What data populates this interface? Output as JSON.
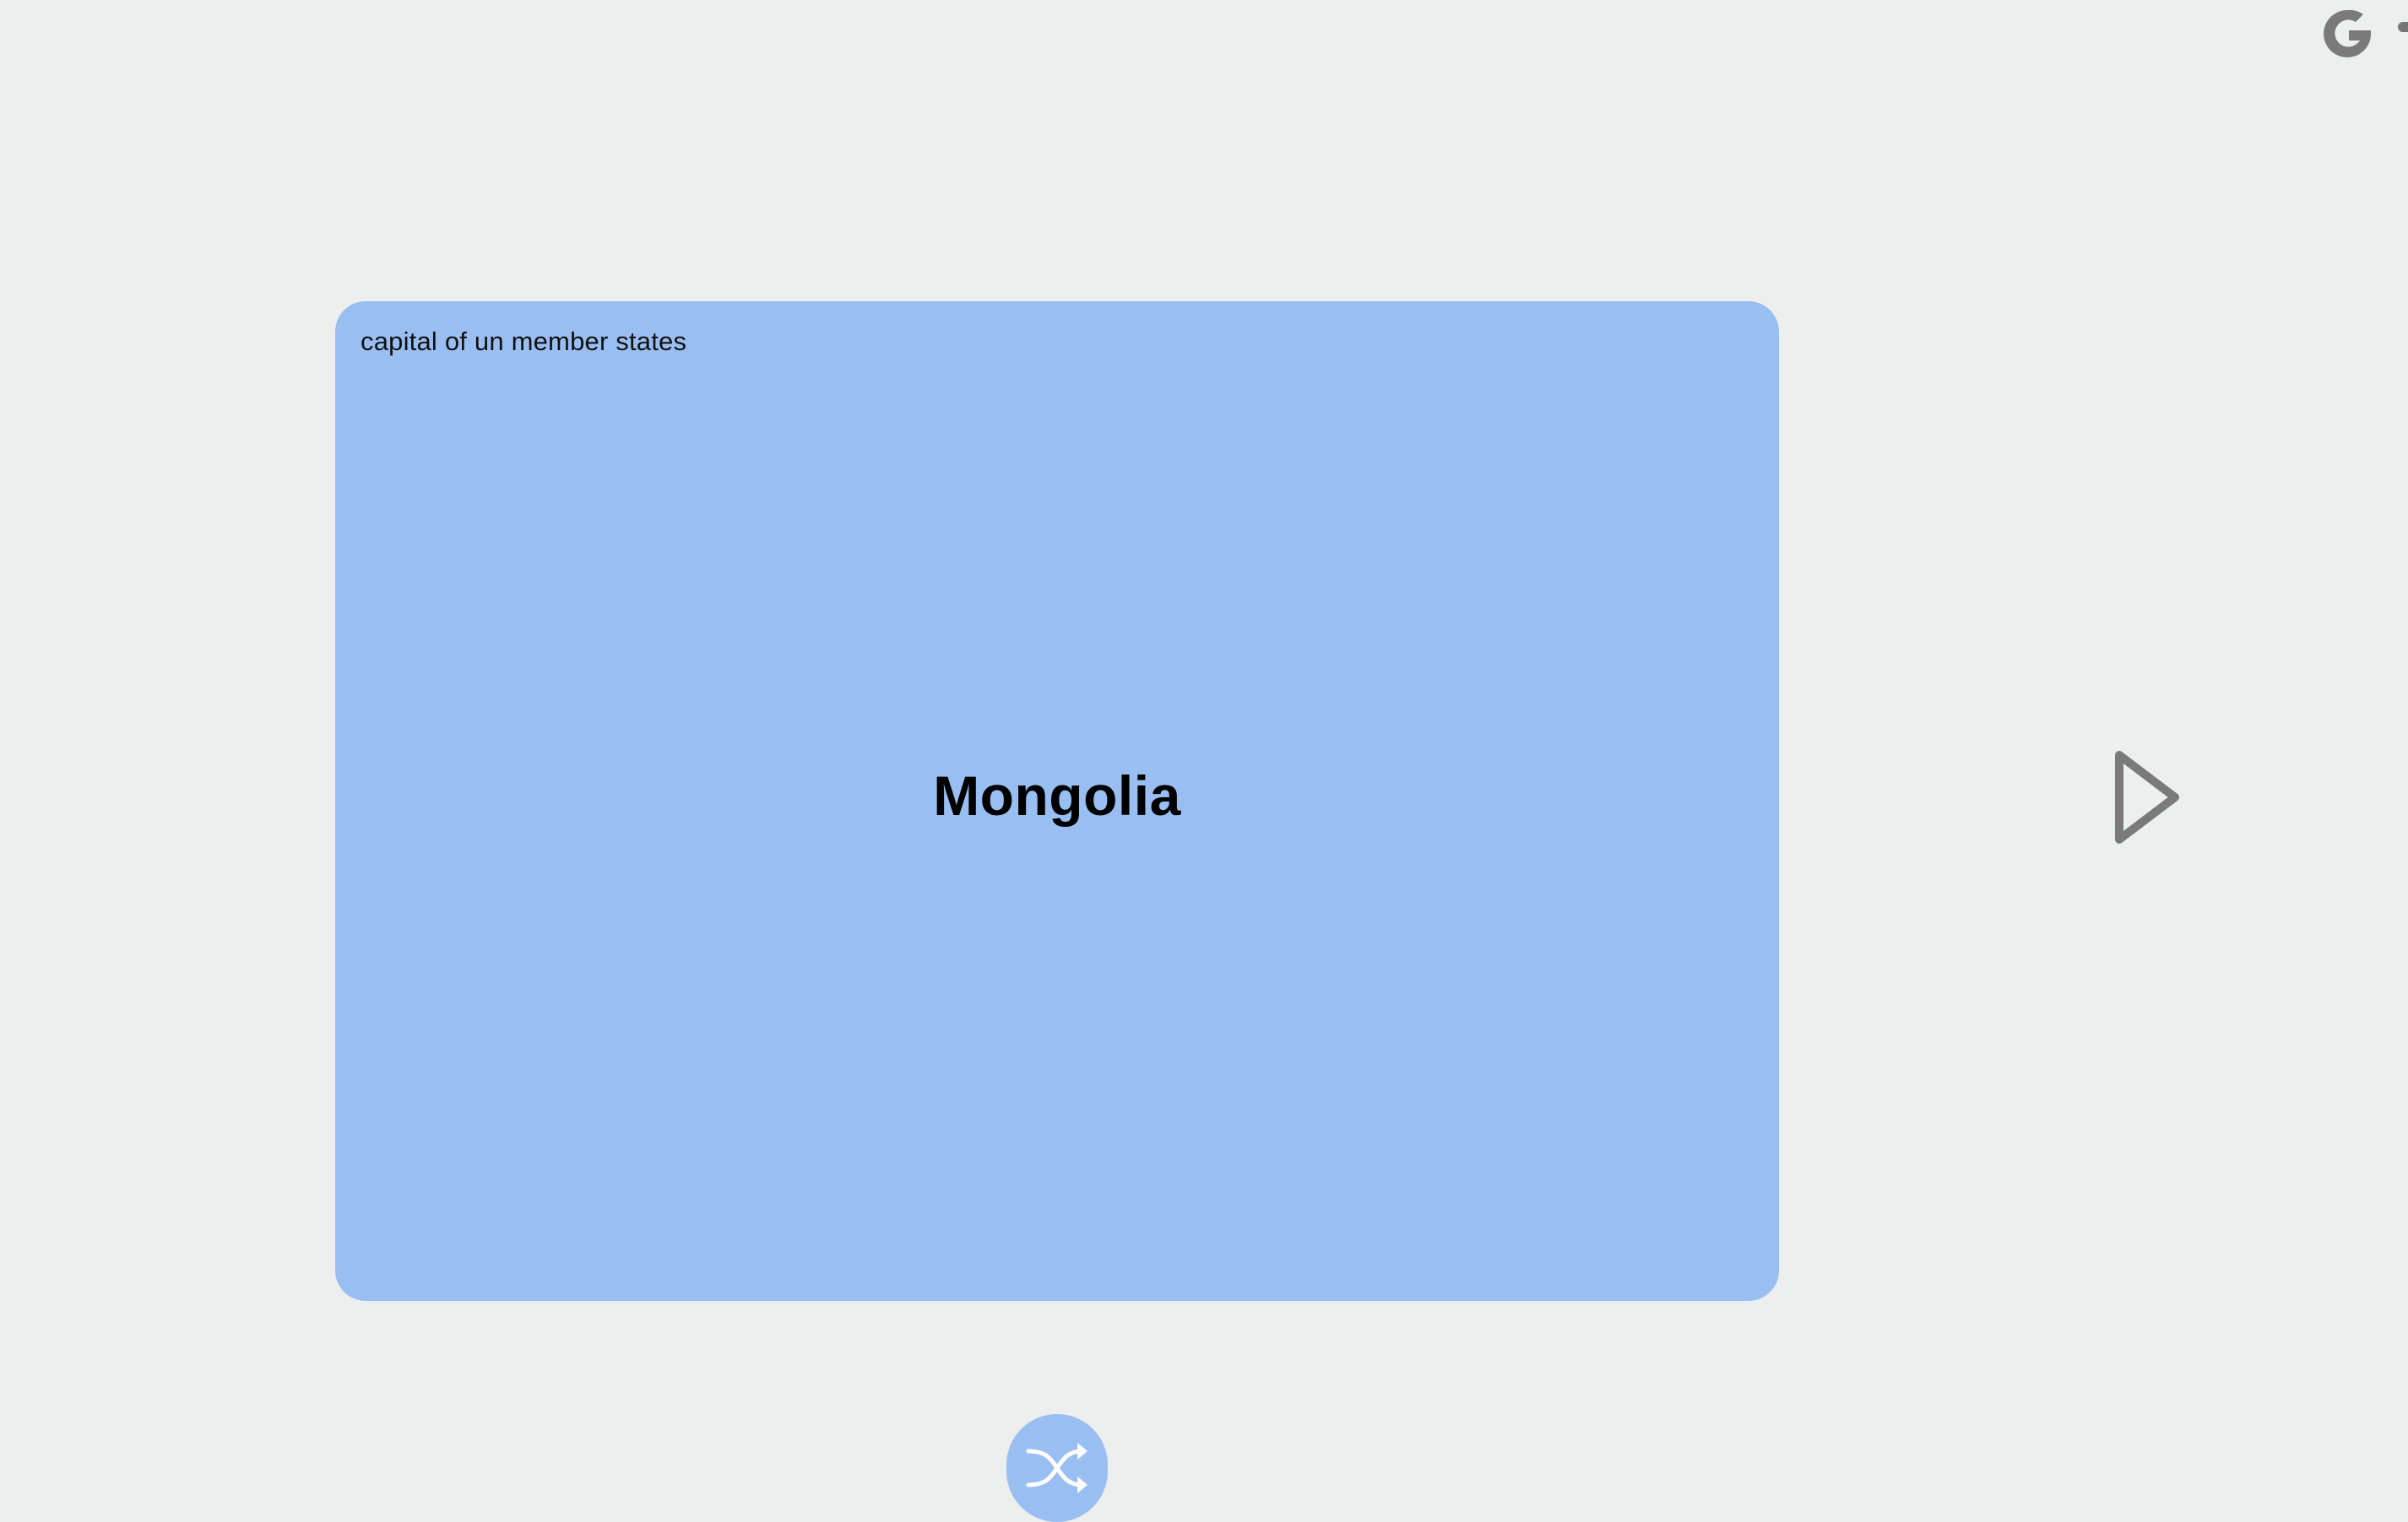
{
  "header": {
    "logo_icon": "google-g-icon"
  },
  "card": {
    "category": "capital of un member states",
    "term": "Mongolia",
    "color": "#99bff2"
  },
  "controls": {
    "next_icon": "play-next-icon",
    "shuffle_icon": "shuffle-icon"
  }
}
